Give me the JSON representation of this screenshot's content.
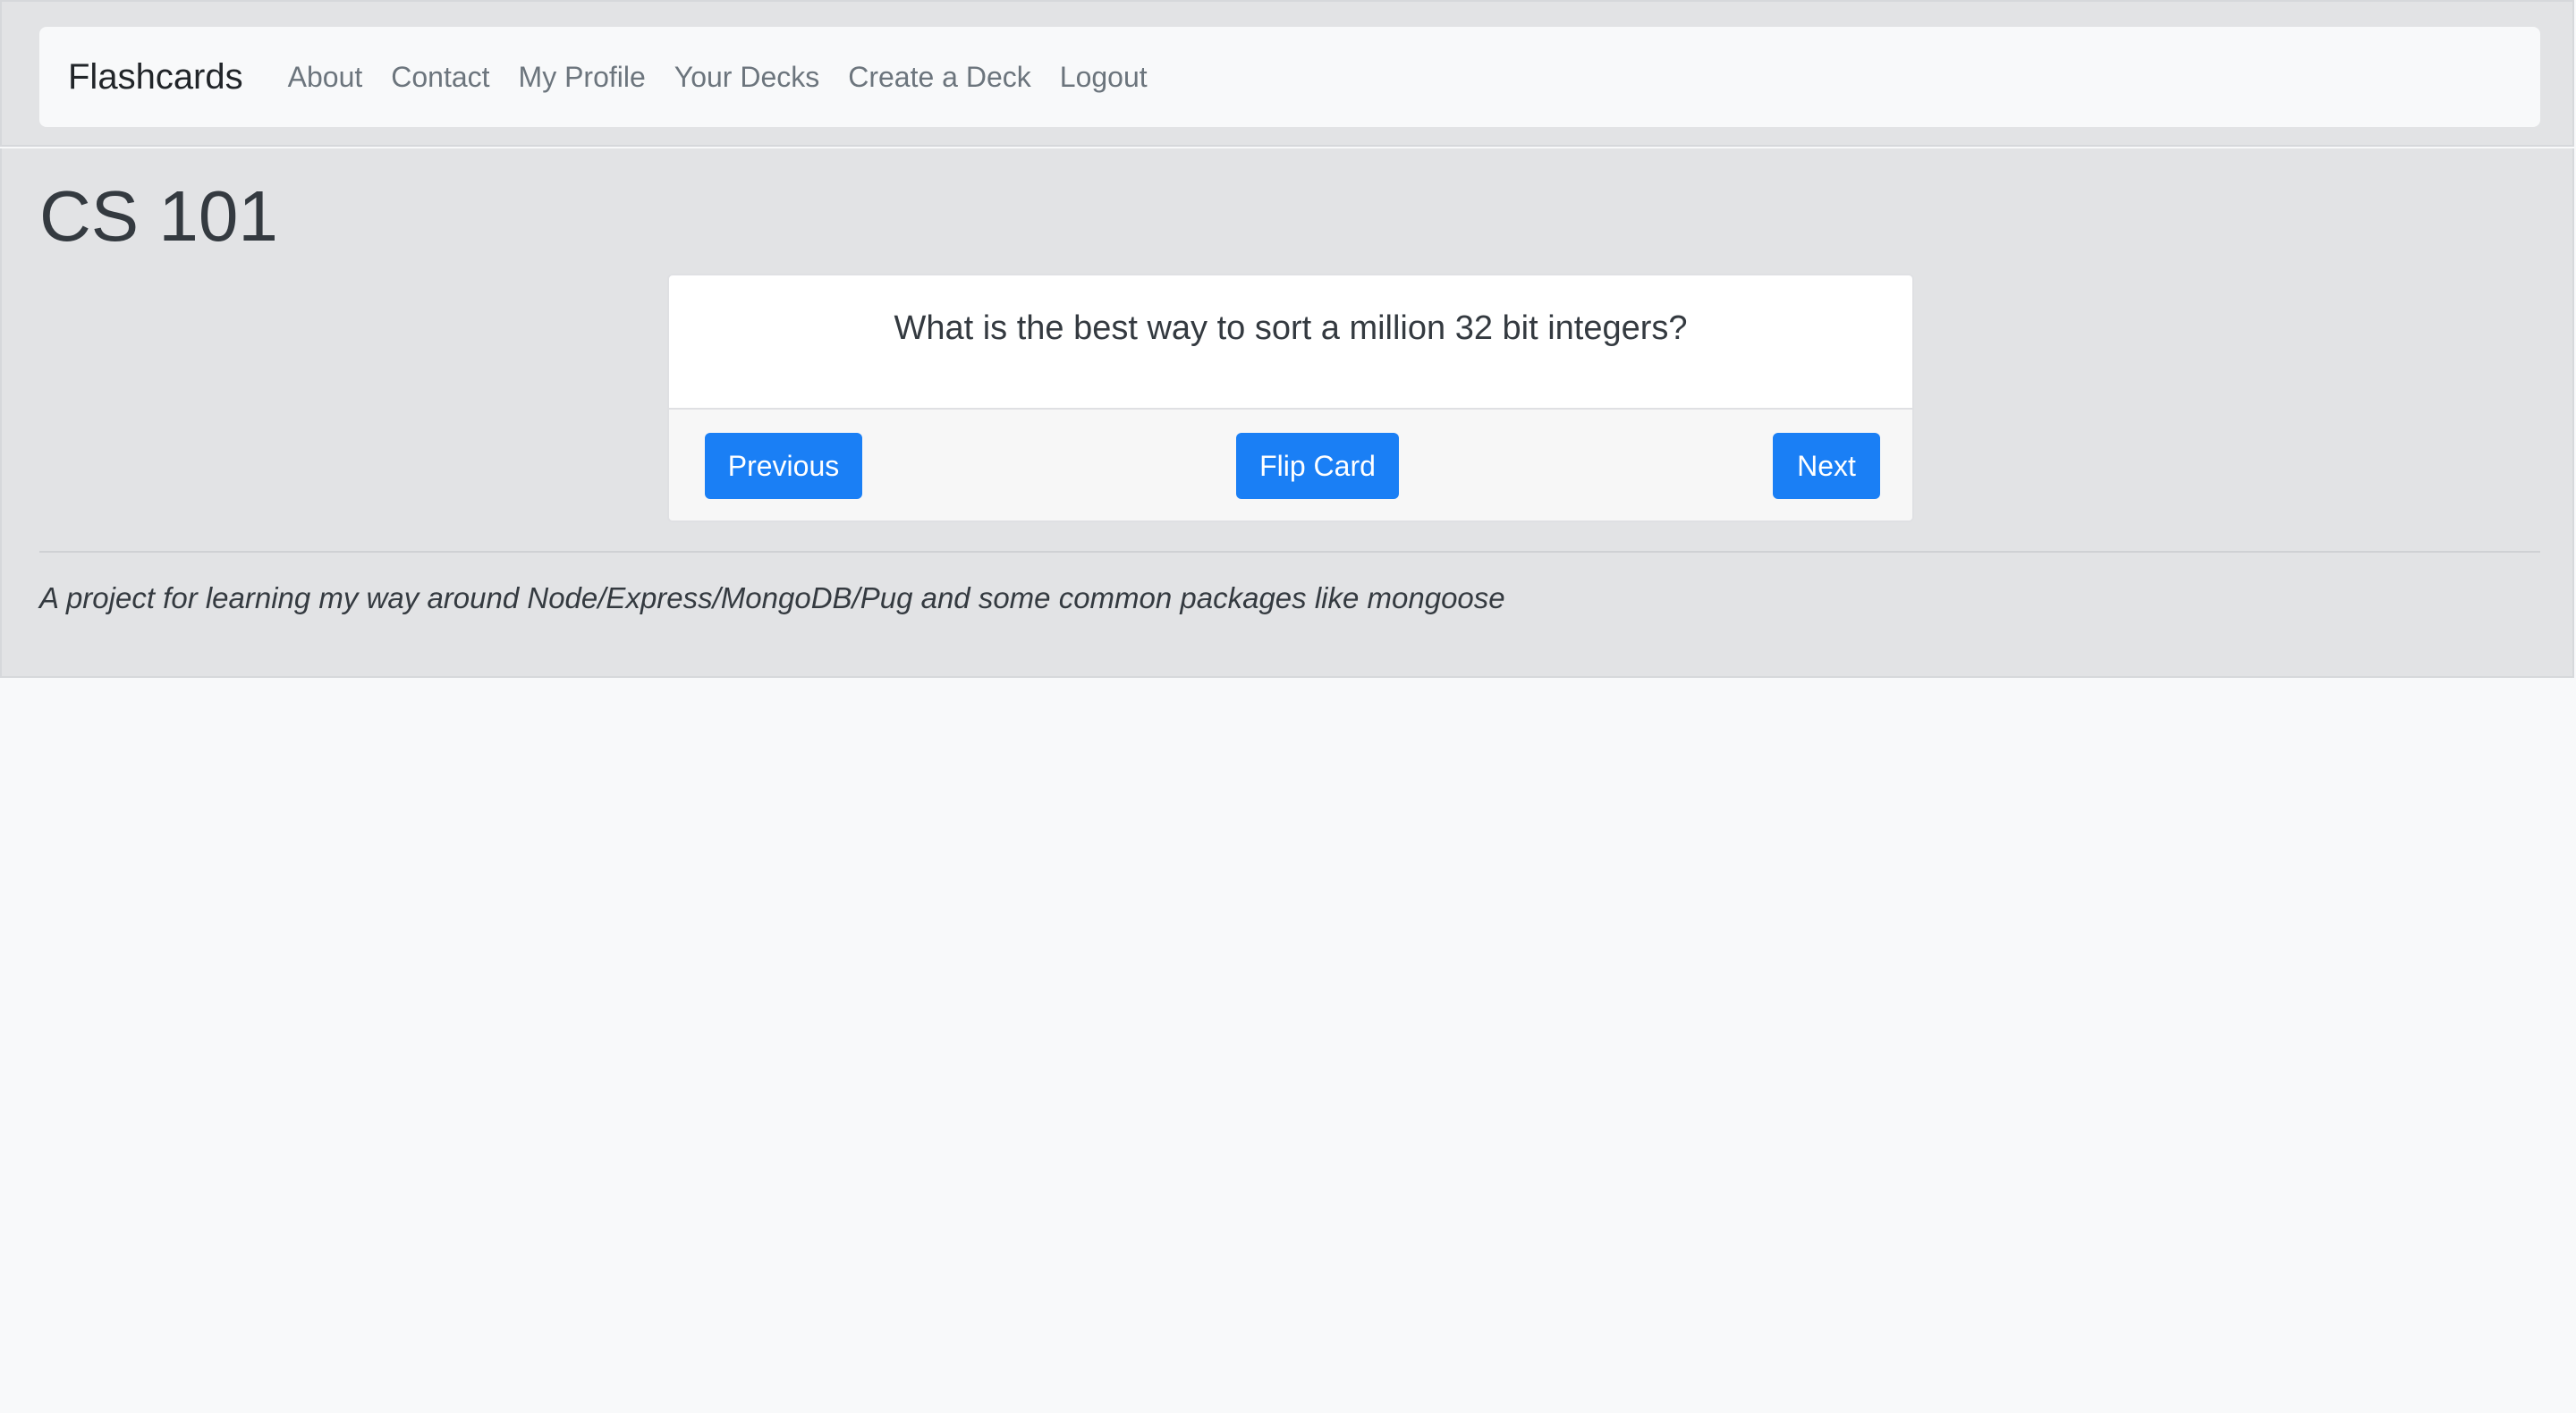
{
  "navbar": {
    "brand": "Flashcards",
    "links": [
      "About",
      "Contact",
      "My Profile",
      "Your Decks",
      "Create a Deck",
      "Logout"
    ]
  },
  "page": {
    "title": "CS 101"
  },
  "card": {
    "question": "What is the best way to sort a million 32 bit integers?",
    "buttons": {
      "previous": "Previous",
      "flip": "Flip Card",
      "next": "Next"
    }
  },
  "footer": {
    "text": "A project for learning my way around Node/Express/MongoDB/Pug and some common packages like mongoose"
  },
  "colors": {
    "primary_button": "#1a7ff5",
    "header_background": "#e2e3e5",
    "navbar_background": "#f8f9fa"
  }
}
